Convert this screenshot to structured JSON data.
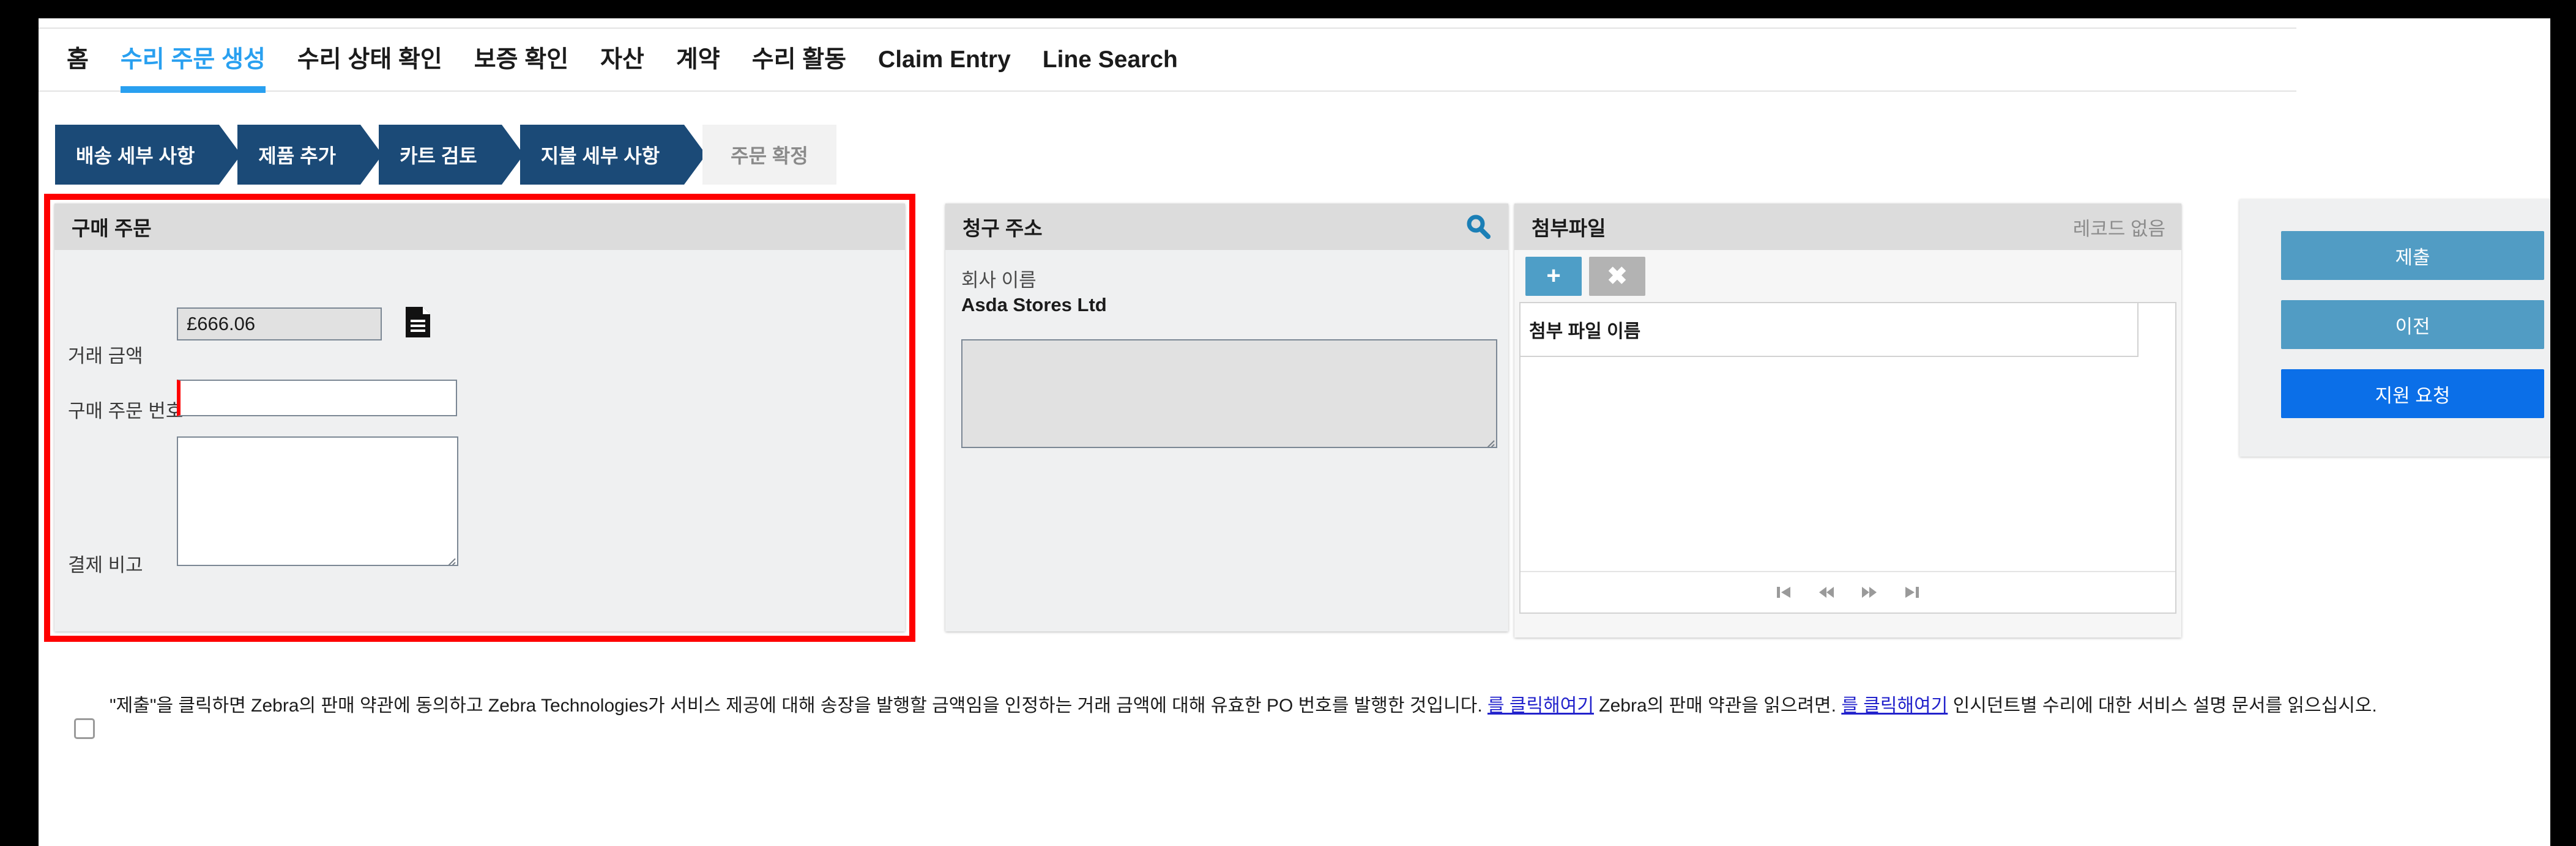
{
  "nav": {
    "tabs": [
      {
        "label": "홈",
        "active": false
      },
      {
        "label": "수리 주문 생성",
        "active": true
      },
      {
        "label": "수리 상태 확인",
        "active": false
      },
      {
        "label": "보증 확인",
        "active": false
      },
      {
        "label": "자산",
        "active": false
      },
      {
        "label": "계약",
        "active": false
      },
      {
        "label": "수리 활동",
        "active": false
      },
      {
        "label": "Claim Entry",
        "active": false
      },
      {
        "label": "Line Search",
        "active": false
      }
    ]
  },
  "wizard": {
    "steps": [
      {
        "label": "배송 세부 사항",
        "state": "done"
      },
      {
        "label": "제품 추가",
        "state": "done"
      },
      {
        "label": "카트 검토",
        "state": "done"
      },
      {
        "label": "지불 세부 사항",
        "state": "done"
      },
      {
        "label": "주문 확정",
        "state": "current"
      }
    ]
  },
  "purchase_order": {
    "title": "구매 주문",
    "transaction_amount_label": "거래 금액",
    "transaction_amount_value": "£666.06",
    "doc_icon": "document-icon",
    "po_number_label": "구매 주문 번호",
    "po_number_value": "",
    "po_number_placeholder": "",
    "payment_notes_label": "결제 비고",
    "payment_notes_value": "",
    "payment_notes_placeholder": ""
  },
  "billing_address": {
    "title": "청구 주소",
    "search_icon": "search-icon",
    "company_name_label": "회사 이름",
    "company_name_value": "Asda Stores Ltd",
    "address_value": "",
    "address_placeholder": ""
  },
  "attachments": {
    "title": "첨부파일",
    "record_status": "레코드 없음",
    "add_button_label": "+",
    "delete_button_label": "✖",
    "grid_column_header": "첨부 파일 이름",
    "rows": [],
    "pager": [
      {
        "icon": "first-page-icon",
        "glyph": "⏮"
      },
      {
        "icon": "previous-page-icon",
        "glyph": "⏪"
      },
      {
        "icon": "next-page-icon",
        "glyph": "⏩"
      },
      {
        "icon": "last-page-icon",
        "glyph": "⏭"
      }
    ]
  },
  "actions": {
    "submit_label": "제출",
    "previous_label": "이전",
    "support_label": "지원 요청"
  },
  "disclaimer": {
    "part1": "\"제출\"을 클릭하면 Zebra의 판매 약관에 동의하고 Zebra Technologies가 서비스 제공에 대해 송장을 발행할 금액임을 인정하는 거래 금액에 대해 유효한 PO 번호를 발행한 것입니다. ",
    "link1": "를 클릭해여기",
    "part2": " Zebra의 판매 약관을 읽으려면. ",
    "link2": "를 클릭해여기",
    "part3": " 인시던트별 수리에 대한 서비스 설명 문서를 읽으십시오."
  },
  "colors": {
    "accent_blue": "#29a0f0",
    "step_blue": "#1b4a77",
    "primary_button": "#0b6fe8",
    "secondary_button": "#519cc4",
    "highlight_red": "#fe0000",
    "link_blue": "#2222cc"
  }
}
